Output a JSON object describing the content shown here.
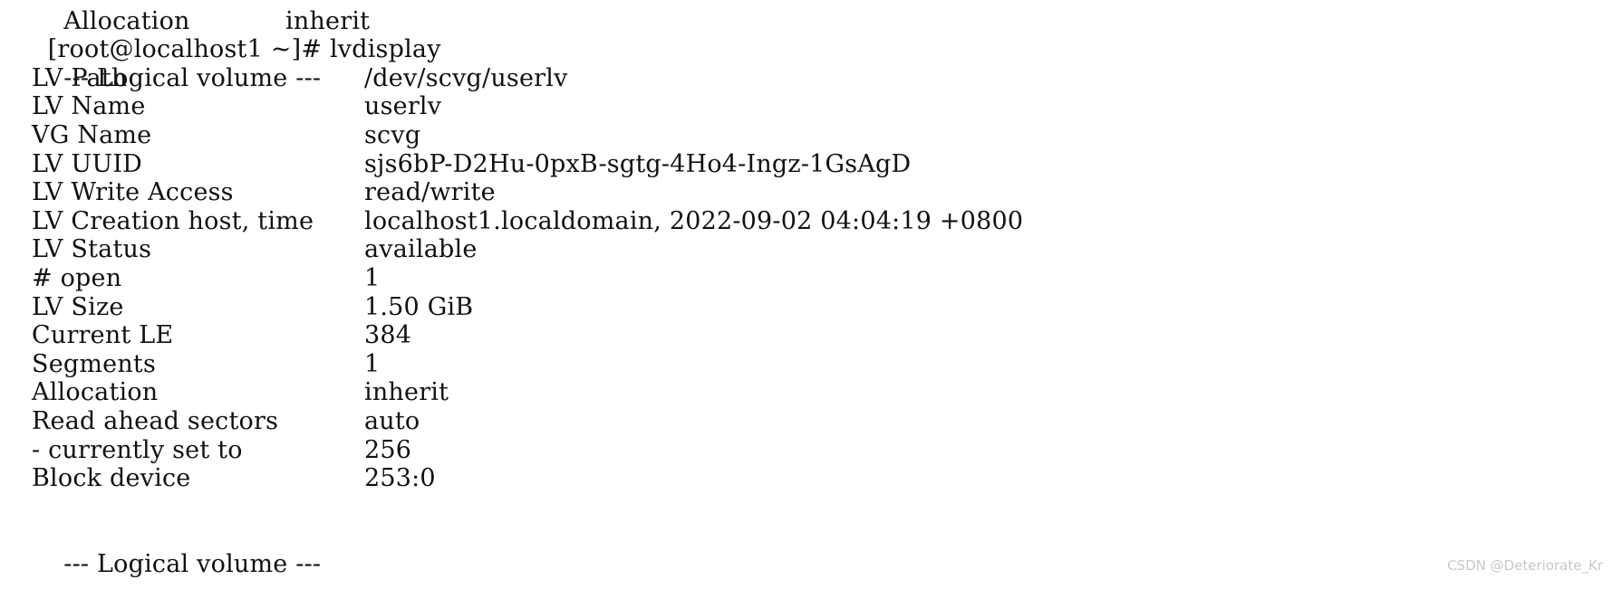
{
  "terminal": {
    "clipped_top_line": "  Allocation            inherit",
    "prompt_line": {
      "prompt": "[root@localhost1 ~]# ",
      "command": "lvdisplay"
    },
    "section_header": "  --- Logical volume ---",
    "rows": [
      {
        "key": "LV Path",
        "value": "/dev/scvg/userlv"
      },
      {
        "key": "LV Name",
        "value": "userlv"
      },
      {
        "key": "VG Name",
        "value": "scvg"
      },
      {
        "key": "LV UUID",
        "value": "sjs6bP-D2Hu-0pxB-sgtg-4Ho4-Ingz-1GsAgD"
      },
      {
        "key": "LV Write Access",
        "value": "read/write"
      },
      {
        "key": "LV Creation host, time",
        "value": "localhost1.localdomain, 2022-09-02 04:04:19 +0800"
      },
      {
        "key": "LV Status",
        "value": "available"
      },
      {
        "key": "# open",
        "value": "1"
      },
      {
        "key": "LV Size",
        "value": "1.50 GiB"
      },
      {
        "key": "Current LE",
        "value": "384"
      },
      {
        "key": "Segments",
        "value": "1"
      },
      {
        "key": "Allocation",
        "value": "inherit"
      },
      {
        "key": "Read ahead sectors",
        "value": "auto"
      },
      {
        "key": "- currently set to",
        "value": "256"
      },
      {
        "key": "Block device",
        "value": "253:0"
      }
    ],
    "trailing_clipped_line": "  --- Logical volume ---"
  },
  "watermark": {
    "text": "CSDN @Deteriorate_Kr"
  },
  "colors": {
    "background": "#ffffff",
    "text": "#111111",
    "watermark": "#c8c8c8"
  }
}
